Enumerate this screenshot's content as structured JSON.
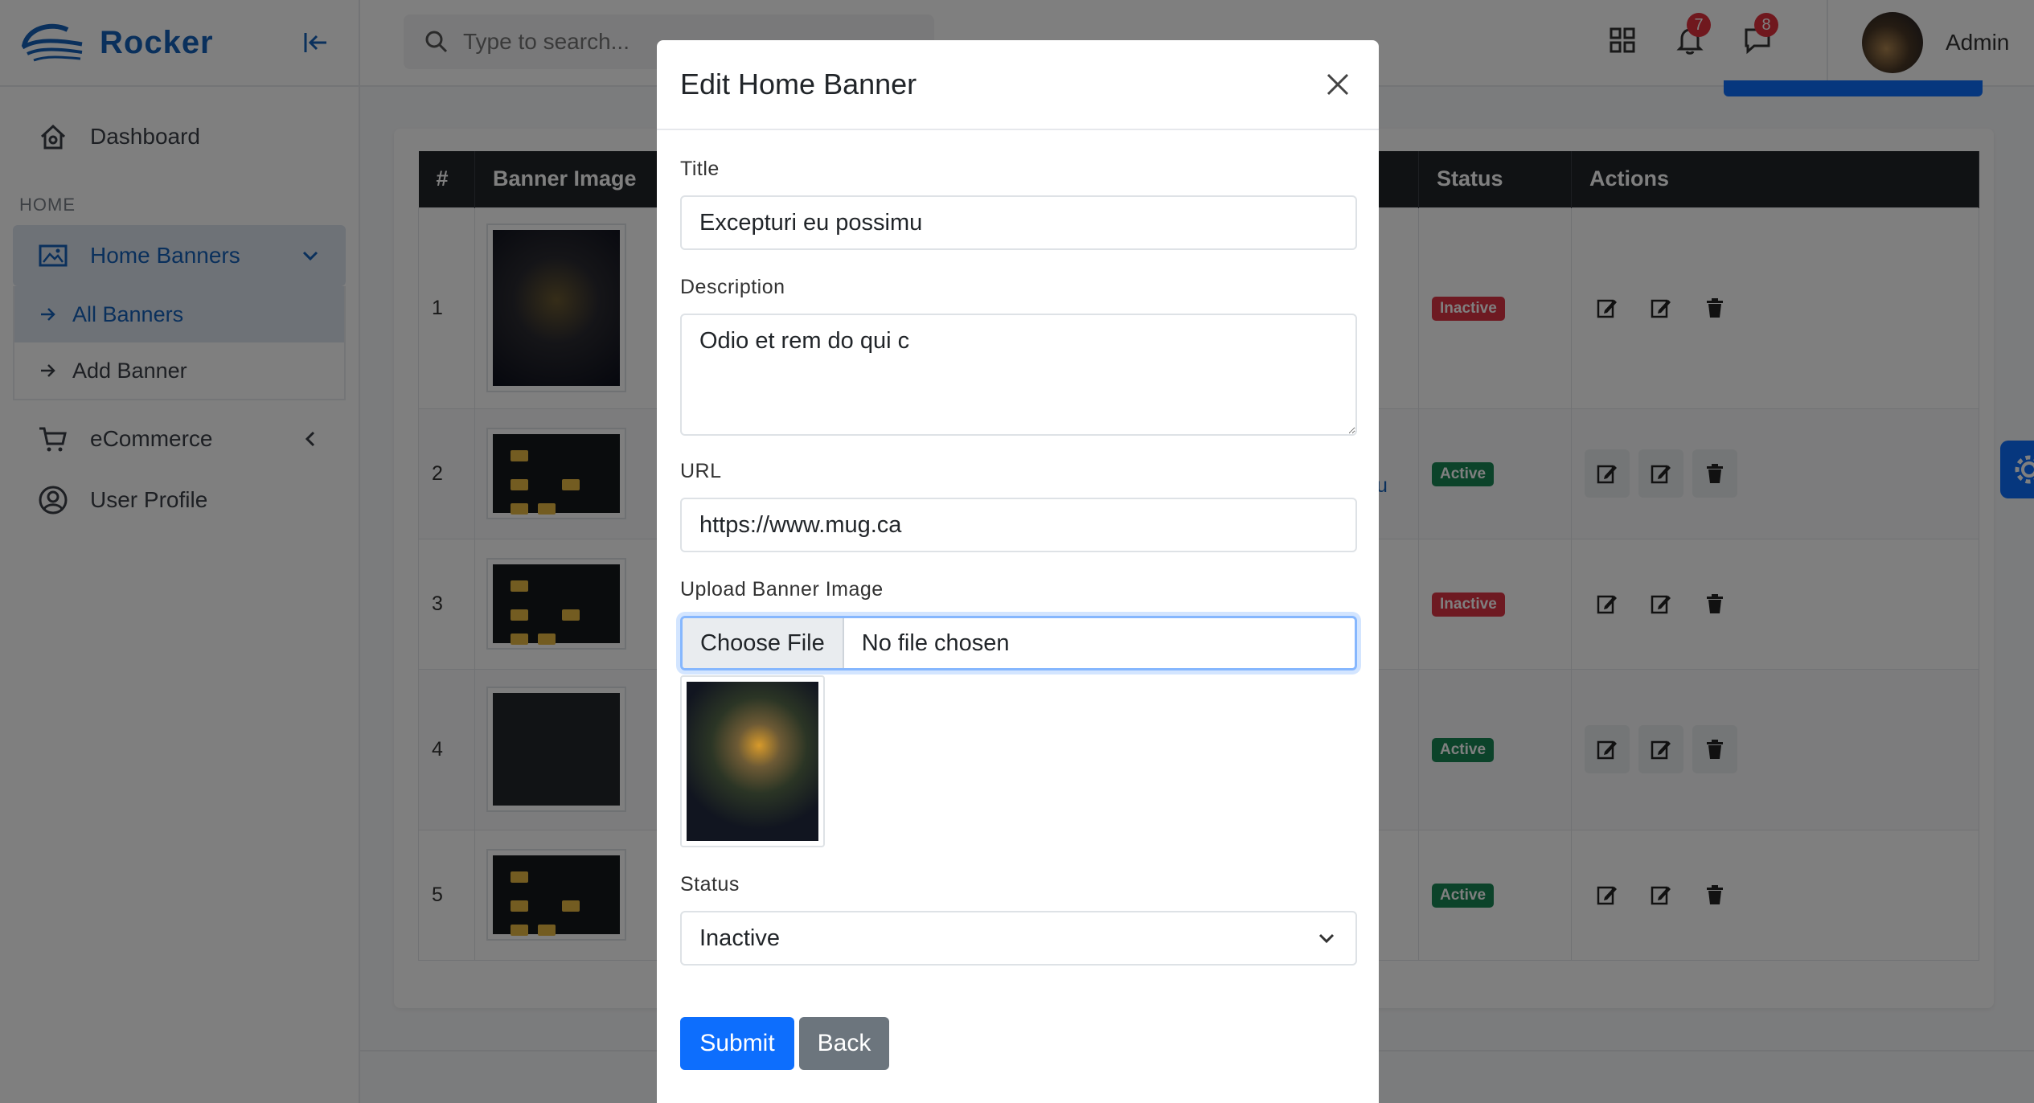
{
  "brand": {
    "name": "Rocker"
  },
  "sidebar": {
    "dashboard": "Dashboard",
    "section_label": "HOME",
    "home_banners": "Home Banners",
    "sub_items": [
      "All Banners",
      "Add Banner"
    ],
    "ecommerce": "eCommerce",
    "user_profile": "User Profile"
  },
  "topbar": {
    "search_placeholder": "Type to search...",
    "notifications_count": "7",
    "messages_count": "8",
    "user_name": "Admin"
  },
  "table": {
    "headers": [
      "#",
      "Banner Image",
      "Status",
      "Actions"
    ],
    "rows": [
      {
        "no": "1",
        "status": "Inactive"
      },
      {
        "no": "2",
        "status": "Active"
      },
      {
        "no": "3",
        "status": "Inactive"
      },
      {
        "no": "4",
        "status": "Active"
      },
      {
        "no": "5",
        "status": "Active"
      }
    ],
    "link_fragment": "u"
  },
  "modal": {
    "title": "Edit Home Banner",
    "title_label": "Title",
    "title_value": "Excepturi eu possimu",
    "description_label": "Description",
    "description_value": "Odio et rem do qui c",
    "url_label": "URL",
    "url_value": "https://www.mug.ca",
    "upload_label": "Upload Banner Image",
    "choose_file": "Choose File",
    "no_file": "No file chosen",
    "status_label": "Status",
    "status_value": "Inactive",
    "submit": "Submit",
    "back": "Back"
  },
  "colors": {
    "accent": "#0d6efd",
    "brand": "#1560b8",
    "danger": "#dc3545",
    "success": "#198754"
  }
}
